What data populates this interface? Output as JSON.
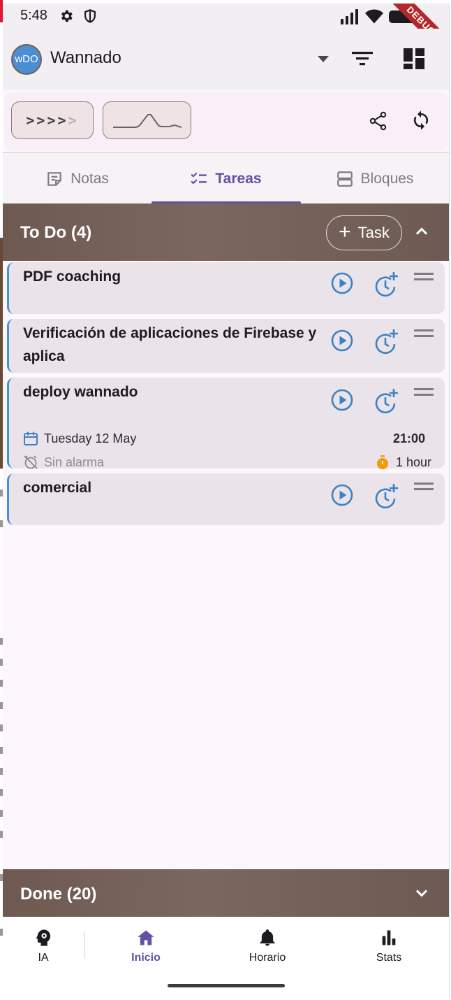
{
  "status_bar": {
    "time": "5:48",
    "debug_banner": "DEBUG"
  },
  "app_bar": {
    "logo_text": "wDO",
    "title": "Wannado"
  },
  "control_card": {
    "progress_arrows_strong": ">>>>",
    "progress_arrows_dim": ">"
  },
  "tabs": [
    {
      "label": "Notas",
      "icon": "note-icon",
      "active": false
    },
    {
      "label": "Tareas",
      "icon": "checklist-icon",
      "active": true
    },
    {
      "label": "Bloques",
      "icon": "blocks-icon",
      "active": false
    }
  ],
  "todo_section": {
    "title": "To Do (4)",
    "add_button_label": "Task",
    "tasks": [
      {
        "title": "PDF coaching"
      },
      {
        "title": "Verificación de aplicaciones de Firebase y aplica"
      },
      {
        "title": "deploy wannado",
        "date": "Tuesday 12 May",
        "time": "21:00",
        "alarm": "Sin alarma",
        "duration": "1 hour"
      },
      {
        "title": "comercial"
      }
    ]
  },
  "done_section": {
    "title": "Done (20)"
  },
  "bottom_nav": [
    {
      "label": "IA",
      "icon": "brain-gear-icon",
      "active": false
    },
    {
      "label": "Inicio",
      "icon": "home-icon",
      "active": true
    },
    {
      "label": "Horario",
      "icon": "bell-icon",
      "active": false
    },
    {
      "label": "Stats",
      "icon": "bar-chart-icon",
      "active": false
    }
  ],
  "colors": {
    "accent": "#6650a4",
    "section_header": "#6f5a52",
    "task_card": "#ebe3ea",
    "task_border": "#4a8fd4",
    "action_icon": "#3b82c4",
    "duration_icon": "#f29b0d"
  }
}
